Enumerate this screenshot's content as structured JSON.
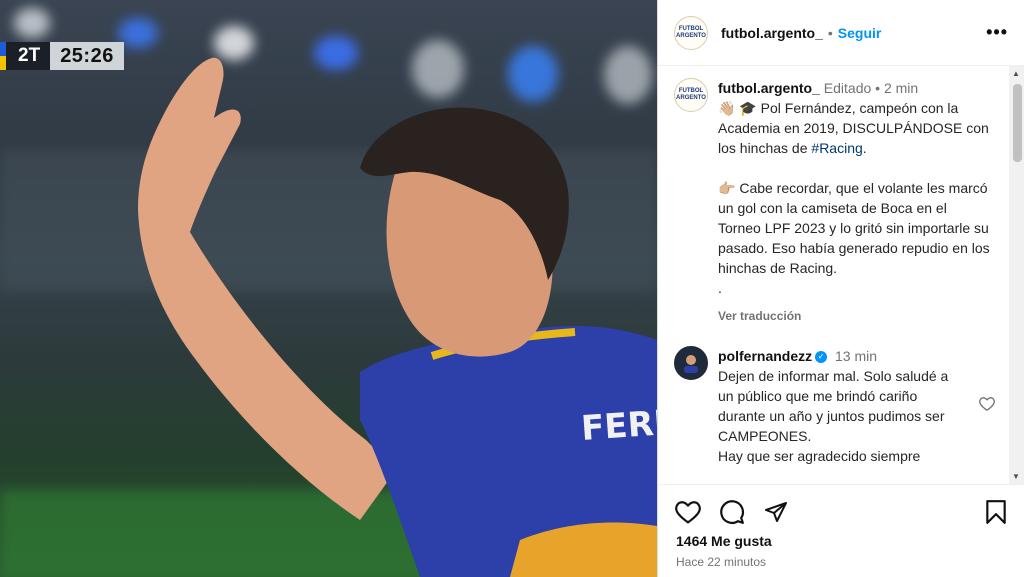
{
  "media": {
    "scoreboard": {
      "half": "2T",
      "clock": "25:26"
    },
    "jersey_text": "FERN"
  },
  "post": {
    "username": "futbol.argento_",
    "follow_label": "Seguir",
    "more_label": "•••",
    "avatar_text": "FUTBOL ARGENTO"
  },
  "caption": {
    "username": "futbol.argento_",
    "edited": "Editado",
    "time": "2 min",
    "line1_emoji": "👋🏼 🎓",
    "line1": "Pol Fernández, campeón con la Academia en 2019, DISCULPÁNDOSE con los hinchas de ",
    "hashtag": "#Racing",
    "line1_end": ".",
    "line2_emoji": "👉🏼",
    "line2": "Cabe recordar, que el volante les marcó un gol con la camiseta de Boca en el Torneo LPF 2023 y lo gritó sin importarle su pasado. Eso había generado repudio en los hinchas de Racing.",
    "line3": ".",
    "translate": "Ver traducción"
  },
  "comment": {
    "username": "polfernandezz",
    "verified_glyph": "✓",
    "time": "13 min",
    "text_line1": "Dejen de informar mal. Solo saludé a un público que me brindó cariño durante un año y juntos pudimos ser CAMPEONES.",
    "text_line2": "Hay que ser agradecido siempre"
  },
  "actions": {
    "likes": "1464 Me gusta",
    "time": "Hace 22 minutos"
  },
  "colors": {
    "accent": "#0095f6",
    "hashtag": "#00376b",
    "muted": "#737373"
  },
  "icons": [
    "heart-icon",
    "comment-icon",
    "share-icon",
    "bookmark-icon",
    "more-icon",
    "verified-icon"
  ]
}
